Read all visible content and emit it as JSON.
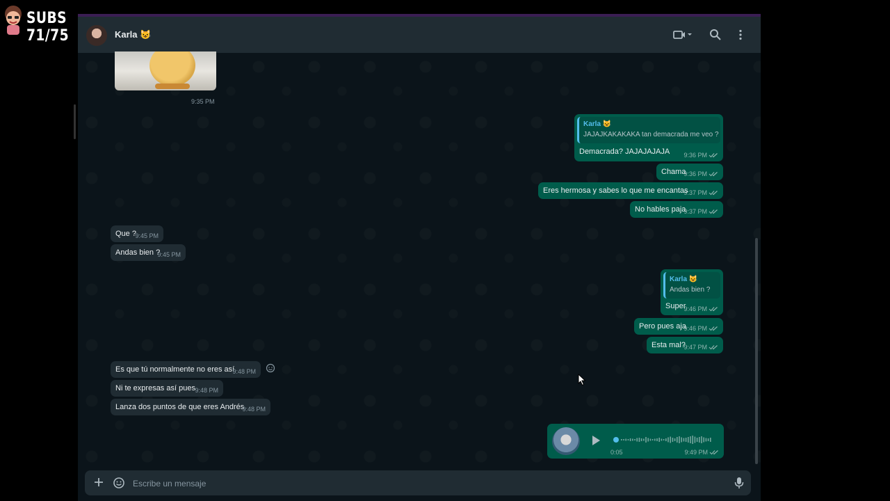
{
  "overlay": {
    "subs_text": "SUBS 71/75"
  },
  "header": {
    "contact_name": "Karla 😺"
  },
  "image_message": {
    "time": "9:35 PM"
  },
  "messages": [
    {
      "id": "m1",
      "dir": "out",
      "quote_name": "Karla 😺",
      "quote_text": "JAJAJKAKAKAKA tan demacrada me veo ?",
      "text": "Demacrada? JAJAJAJAJA",
      "time": "9:36 PM"
    },
    {
      "id": "m2",
      "dir": "out",
      "text": "Chama",
      "time": "9:36 PM"
    },
    {
      "id": "m3",
      "dir": "out",
      "text": "Eres hermosa y sabes lo que me encantas",
      "time": "9:37 PM"
    },
    {
      "id": "m4",
      "dir": "out",
      "text": "No hables paja",
      "time": "9:37 PM"
    },
    {
      "id": "m5",
      "dir": "in",
      "text": "Que ?",
      "time": "9:45 PM"
    },
    {
      "id": "m6",
      "dir": "in",
      "text": "Andas bien ?",
      "time": "9:45 PM"
    },
    {
      "id": "m7",
      "dir": "out",
      "quote_name": "Karla 😺",
      "quote_text": "Andas bien ?",
      "text": "Super",
      "time": "9:46 PM"
    },
    {
      "id": "m8",
      "dir": "out",
      "text": "Pero pues aja",
      "time": "9:46 PM"
    },
    {
      "id": "m9",
      "dir": "out",
      "text": "Esta mal?",
      "time": "9:47 PM"
    },
    {
      "id": "m10",
      "dir": "in",
      "text": "Es que tú normalmente no eres así",
      "time": "9:48 PM"
    },
    {
      "id": "m11",
      "dir": "in",
      "text": "Ni te expresas así pues",
      "time": "9:48 PM"
    },
    {
      "id": "m12",
      "dir": "in",
      "text": "Lanza dos puntos de que eres Andrés",
      "time": "9:48 PM"
    }
  ],
  "voice_message": {
    "duration": "0:05",
    "time": "9:49 PM",
    "progress": 0.0
  },
  "composer": {
    "placeholder": "Escribe un mensaje"
  },
  "colors": {
    "incoming": "#202c33",
    "outgoing": "#005c4b",
    "background": "#0b141a",
    "accent": "#53bdeb"
  }
}
